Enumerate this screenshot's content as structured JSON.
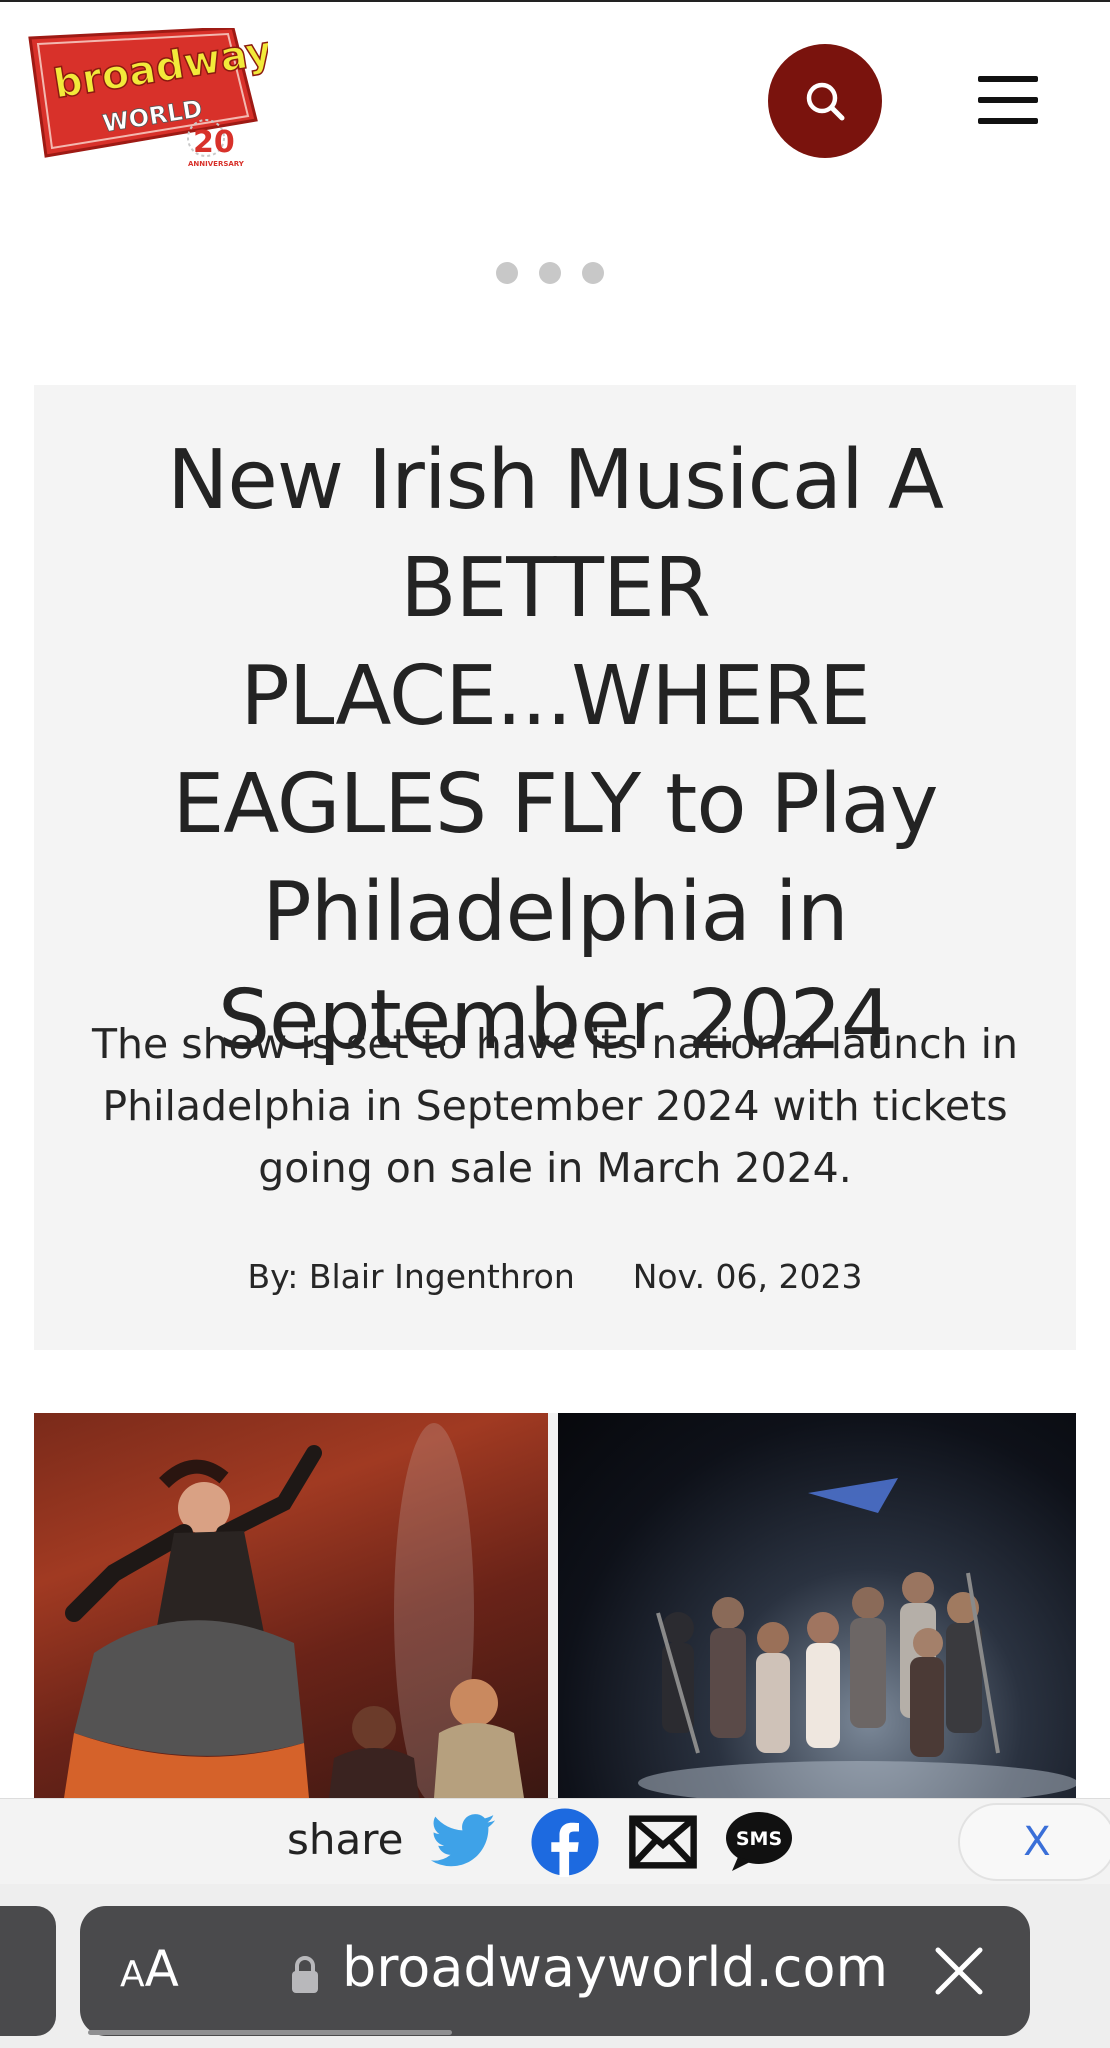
{
  "header": {
    "logo": {
      "word1": "broadway",
      "word2": "WORLD",
      "badge_number": "20",
      "badge_text": "ANNIVERSARY"
    },
    "search_icon": "search-icon",
    "menu_icon": "hamburger-menu-icon"
  },
  "carousel": {
    "dot_count": 3
  },
  "article": {
    "headline": "New Irish Musical A BETTER PLACE...WHERE EAGLES FLY to Play Philadelphia in September 2024",
    "subheadline": "The show is set to have its national launch in Philadelphia in September 2024 with tickets going on sale in March 2024.",
    "author": "By: Blair Ingenthron",
    "date": "Nov. 06, 2023"
  },
  "share_bar": {
    "label": "share",
    "icons": [
      "twitter-icon",
      "facebook-icon",
      "email-icon",
      "sms-icon"
    ],
    "sms_text": "SMS",
    "close_label": "X"
  },
  "browser": {
    "aa_label_small": "A",
    "aa_label_large": "A",
    "url": "broadwayworld.com"
  },
  "colors": {
    "brand_red": "#7a130d",
    "card_bg": "#f4f4f4",
    "twitter_blue": "#3ea2e8",
    "facebook_blue": "#1d6ae0",
    "close_blue": "#3a6fd8"
  }
}
